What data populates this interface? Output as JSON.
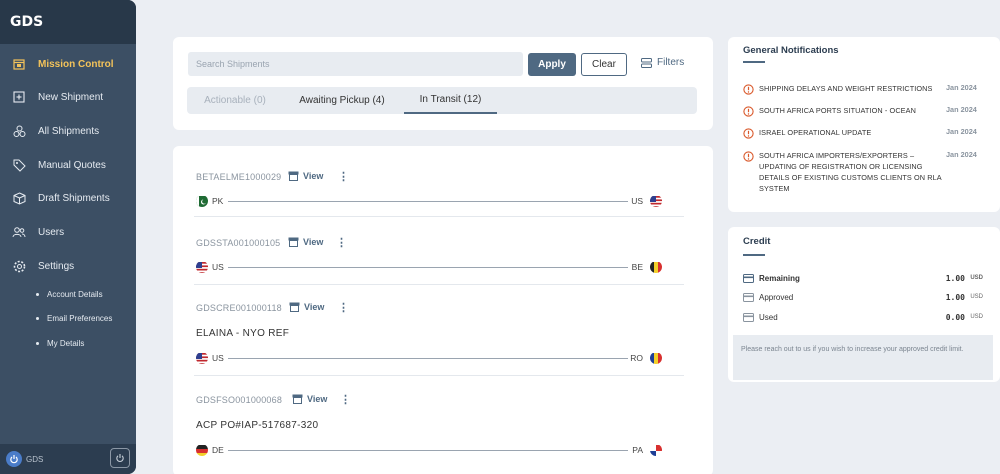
{
  "app": {
    "brand": "GDS"
  },
  "sidebar": {
    "items": [
      {
        "label": "Mission Control",
        "icon": "calendar-icon"
      },
      {
        "label": "New Shipment",
        "icon": "plus-box-icon"
      },
      {
        "label": "All Shipments",
        "icon": "boxes-icon"
      },
      {
        "label": "Manual Quotes",
        "icon": "tag-icon"
      },
      {
        "label": "Draft Shipments",
        "icon": "draft-box-icon"
      },
      {
        "label": "Users",
        "icon": "users-icon"
      },
      {
        "label": "Settings",
        "icon": "gear-icon"
      }
    ],
    "subitems": [
      "Account Details",
      "Email Preferences",
      "My Details"
    ],
    "footer": {
      "user": "GDS"
    }
  },
  "toolbar": {
    "search_placeholder": "Search Shipments",
    "apply_label": "Apply",
    "clear_label": "Clear",
    "filters_label": "Filters"
  },
  "tabs": [
    {
      "label": "Actionable (0)"
    },
    {
      "label": "Awaiting Pickup (4)"
    },
    {
      "label": "In Transit (12)"
    }
  ],
  "shipments": [
    {
      "ref": "BETAELME1000029",
      "view": "View",
      "title": "",
      "from": "PK",
      "to": "US"
    },
    {
      "ref": "GDSSTA001000105",
      "view": "View",
      "title": "",
      "from": "US",
      "to": "BE"
    },
    {
      "ref": "GDSCRE001000118",
      "view": "View",
      "title": "ELAINA - NYO REF",
      "from": "US",
      "to": "RO"
    },
    {
      "ref": "GDSFSO001000068",
      "view": "View",
      "title": "ACP PO#IAP-517687-320",
      "from": "DE",
      "to": "PA"
    }
  ],
  "notifications": {
    "title": "General Notifications",
    "items": [
      {
        "text": "SHIPPING DELAYS AND WEIGHT RESTRICTIONS",
        "date": "Jan 2024"
      },
      {
        "text": "SOUTH AFRICA PORTS SITUATION - OCEAN",
        "date": "Jan 2024"
      },
      {
        "text": "ISRAEL OPERATIONAL UPDATE",
        "date": "Jan 2024"
      },
      {
        "text": "SOUTH AFRICA IMPORTERS/EXPORTERS – UPDATING OF REGISTRATION OR LICENSING DETAILS OF EXISTING CUSTOMS CLIENTS ON RLA SYSTEM",
        "date": "Jan 2024"
      }
    ]
  },
  "credit": {
    "title": "Credit",
    "rows": [
      {
        "label": "Remaining",
        "value": "1.00",
        "unit": "USD"
      },
      {
        "label": "Approved",
        "value": "1.00",
        "unit": "USD"
      },
      {
        "label": "Used",
        "value": "0.00",
        "unit": "USD"
      }
    ],
    "note": "Please reach out to us if you wish to increase your approved credit limit."
  },
  "colors": {
    "sidebar": "#3c4f64",
    "accent": "#4f6982",
    "active": "#f3c35a",
    "warning": "#d9582a"
  }
}
